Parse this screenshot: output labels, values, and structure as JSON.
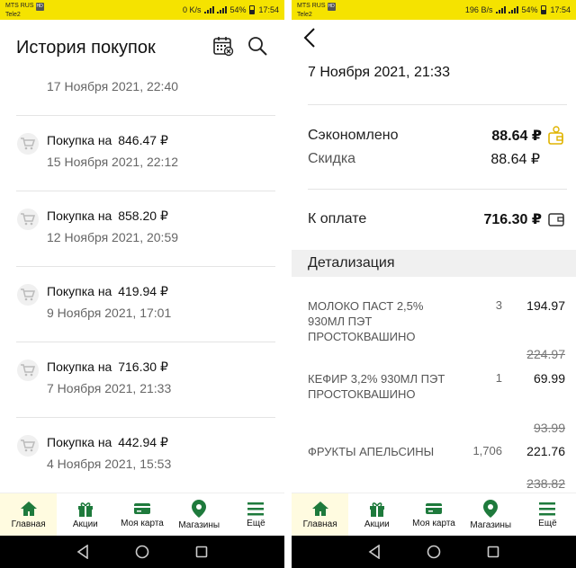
{
  "left": {
    "status": {
      "carrier": "MTS RUS",
      "carrier2": "Tele2",
      "net": "0 K/s",
      "battery": "54%",
      "time": "17:54"
    },
    "title": "История покупок",
    "first_date": "17 Ноября 2021, 22:40",
    "purchases": [
      {
        "label": "Покупка на",
        "amount": "846.47 ₽",
        "date": "15 Ноября 2021, 22:12"
      },
      {
        "label": "Покупка на",
        "amount": "858.20 ₽",
        "date": "12 Ноября 2021, 20:59"
      },
      {
        "label": "Покупка на",
        "amount": "419.94 ₽",
        "date": "9 Ноября 2021, 17:01"
      },
      {
        "label": "Покупка на",
        "amount": "716.30 ₽",
        "date": "7 Ноября 2021, 21:33"
      },
      {
        "label": "Покупка на",
        "amount": "442.94 ₽",
        "date": "4 Ноября 2021, 15:53"
      }
    ]
  },
  "right": {
    "status": {
      "carrier": "MTS RUS",
      "carrier2": "Tele2",
      "net": "196 B/s",
      "battery": "54%",
      "time": "17:54"
    },
    "date": "7 Ноября 2021, 21:33",
    "saved_label": "Сэкономлено",
    "saved_value": "88.64 ₽",
    "discount_label": "Скидка",
    "discount_value": "88.64 ₽",
    "pay_label": "К оплате",
    "pay_value": "716.30 ₽",
    "section": "Детализация",
    "items": [
      {
        "name": "МОЛОКО ПАСТ 2,5% 930МЛ ПЭТ ПРОСТОКВАШИНО",
        "qty": "3",
        "price": "194.97",
        "old_price": "224.97"
      },
      {
        "name": "КЕФИР 3,2% 930МЛ ПЭТ ПРОСТОКВАШИНО",
        "qty": "1",
        "price": "69.99",
        "old_price": "93.99"
      },
      {
        "name": "ФРУКТЫ АПЕЛЬСИНЫ",
        "qty": "1,706",
        "price": "221.76",
        "old_price": "238.82"
      }
    ]
  },
  "nav": [
    {
      "label": "Главная",
      "icon": "home-icon"
    },
    {
      "label": "Акции",
      "icon": "gift-icon"
    },
    {
      "label": "Моя карта",
      "icon": "card-icon"
    },
    {
      "label": "Магазины",
      "icon": "map-pin-icon"
    },
    {
      "label": "Ещё",
      "icon": "menu-icon"
    }
  ],
  "colors": {
    "accent": "#f5e300",
    "brand_green": "#1e7a3c",
    "nav_active_bg": "#fffbe0"
  }
}
